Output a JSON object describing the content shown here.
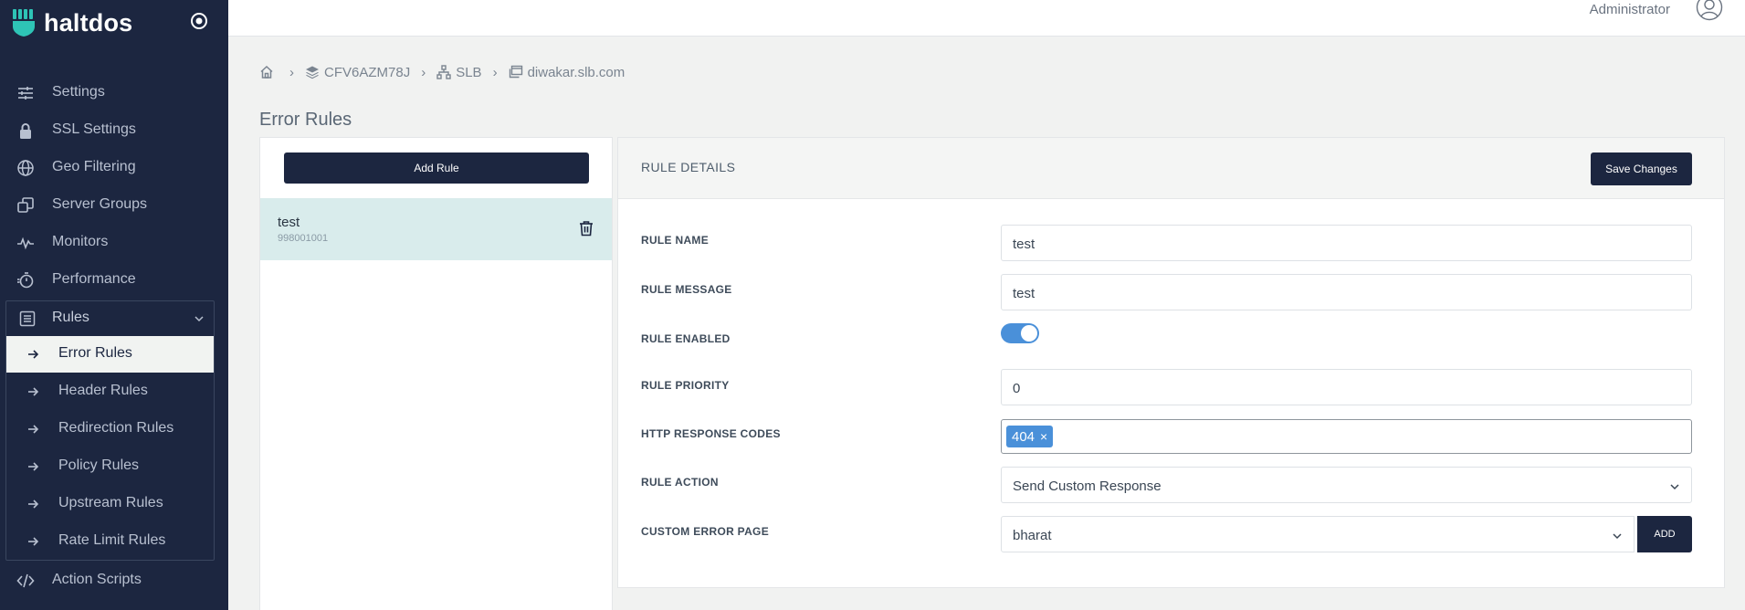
{
  "app": {
    "brand": "haltdos"
  },
  "topbar": {
    "user": "Administrator"
  },
  "sidebar": {
    "items": [
      {
        "label": "Settings",
        "icon": "sliders-icon"
      },
      {
        "label": "SSL Settings",
        "icon": "lock-icon"
      },
      {
        "label": "Geo Filtering",
        "icon": "globe-icon"
      },
      {
        "label": "Server Groups",
        "icon": "copy-icon"
      },
      {
        "label": "Monitors",
        "icon": "pulse-icon"
      },
      {
        "label": "Performance",
        "icon": "stopwatch-icon"
      }
    ],
    "rules": {
      "label": "Rules",
      "items": [
        {
          "label": "Error Rules",
          "active": true
        },
        {
          "label": "Header Rules"
        },
        {
          "label": "Redirection Rules"
        },
        {
          "label": "Policy Rules"
        },
        {
          "label": "Upstream Rules"
        },
        {
          "label": "Rate Limit Rules"
        }
      ]
    },
    "action_scripts": {
      "label": "Action Scripts",
      "icon": "code-icon"
    }
  },
  "breadcrumb": {
    "items": [
      {
        "label": "CFV6AZM78J",
        "icon": "layers-icon"
      },
      {
        "label": "SLB",
        "icon": "sitemap-icon"
      },
      {
        "label": "diwakar.slb.com",
        "icon": "window-icon"
      }
    ]
  },
  "page": {
    "title": "Error Rules"
  },
  "rule_list": {
    "add_label": "Add Rule",
    "items": [
      {
        "name": "test",
        "id": "998001001"
      }
    ]
  },
  "details": {
    "title": "RULE DETAILS",
    "save_label": "Save Changes",
    "fields": {
      "name_label": "RULE NAME",
      "name_value": "test",
      "message_label": "RULE MESSAGE",
      "message_value": "test",
      "enabled_label": "RULE ENABLED",
      "enabled": true,
      "priority_label": "RULE PRIORITY",
      "priority_value": "0",
      "codes_label": "HTTP RESPONSE CODES",
      "codes": [
        "404"
      ],
      "action_label": "RULE ACTION",
      "action_value": "Send Custom Response",
      "error_page_label": "CUSTOM ERROR PAGE",
      "error_page_value": "bharat",
      "add_label": "ADD"
    }
  },
  "colors": {
    "sidebar_bg": "#1c2640",
    "accent": "#4a90d9",
    "selected_row": "#d9ecec"
  }
}
